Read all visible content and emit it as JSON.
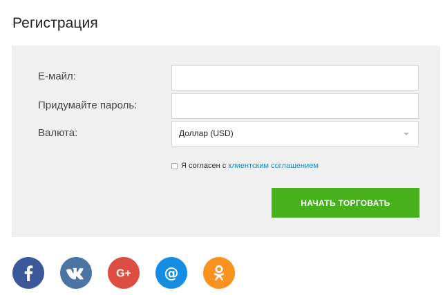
{
  "registration": {
    "title": "Регистрация",
    "email_label": "Е-майл:",
    "email_value": "",
    "password_label": "Придумайте пароль:",
    "password_value": "",
    "currency_label": "Валюта:",
    "currency_selected": "Доллар (USD)",
    "agreement_text": "Я согласен с ",
    "agreement_link": "клиентским соглашением",
    "agreement_checked": false,
    "submit_label": "НАЧАТЬ ТОРГОВАТЬ"
  },
  "socials": [
    {
      "name": "facebook-icon",
      "color": "#3b5998"
    },
    {
      "name": "vk-icon",
      "color": "#4c75a3"
    },
    {
      "name": "google-plus-icon",
      "color": "#dc4e41"
    },
    {
      "name": "mail-icon",
      "color": "#168de2"
    },
    {
      "name": "odnoklassniki-icon",
      "color": "#f7931e"
    }
  ],
  "colors": {
    "accent": "#47b01d",
    "link": "#1a92c6",
    "panel": "#f0f0f0"
  }
}
